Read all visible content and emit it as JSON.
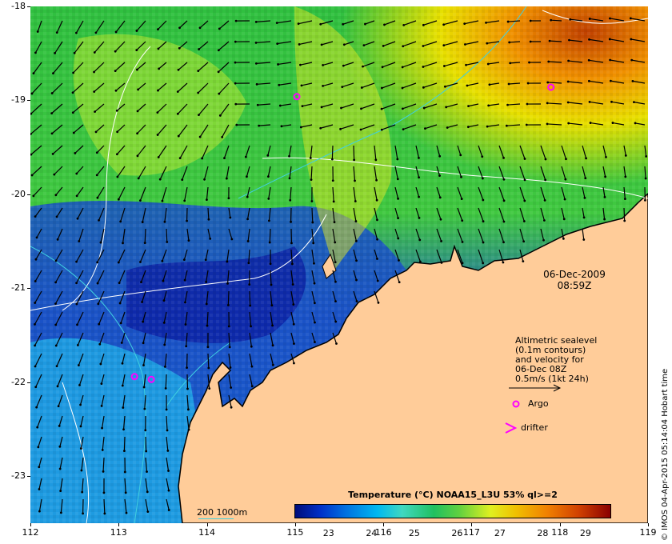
{
  "map": {
    "lon_ticks": [
      "112",
      "113",
      "114",
      "115",
      "116",
      "117",
      "118",
      "119"
    ],
    "lat_ticks": [
      "-18",
      "-19",
      "-20",
      "-21",
      "-22",
      "-23"
    ],
    "lon_range": [
      112,
      119
    ],
    "lat_range": [
      -23.5,
      -18
    ],
    "land_color": "#ffcc99",
    "coastline_color": "#000000",
    "sealevel_contour_color": "#ffffff",
    "isobath_color": "#40d0e0"
  },
  "date": {
    "day": "06-Dec-2009",
    "time": "08:59Z"
  },
  "legend": {
    "lines": [
      "Altimetric sealevel",
      "(0.1m contours)",
      "and velocity for",
      "06-Dec 08Z",
      "0.5m/s (1kt 24h)"
    ],
    "argo_label": "Argo",
    "drifter_label": "drifter",
    "argo_color": "#ff00ff",
    "isobath_label": "200  1000m"
  },
  "argo_floats": [
    {
      "lon": 115.02,
      "lat": -18.96
    },
    {
      "lon": 117.9,
      "lat": -18.86
    },
    {
      "lon": 113.18,
      "lat": -21.94
    },
    {
      "lon": 113.37,
      "lat": -21.97
    }
  ],
  "colorbar": {
    "title": "Temperature (°C) NOAA15_L3U 53% ql>=2",
    "ticks": [
      "23",
      "24",
      "25",
      "26",
      "27",
      "28",
      "29"
    ],
    "min": 22.2,
    "max": 29.6
  },
  "credit": "© IMOS 04-Apr-2015 05:14:04 Hobart time"
}
